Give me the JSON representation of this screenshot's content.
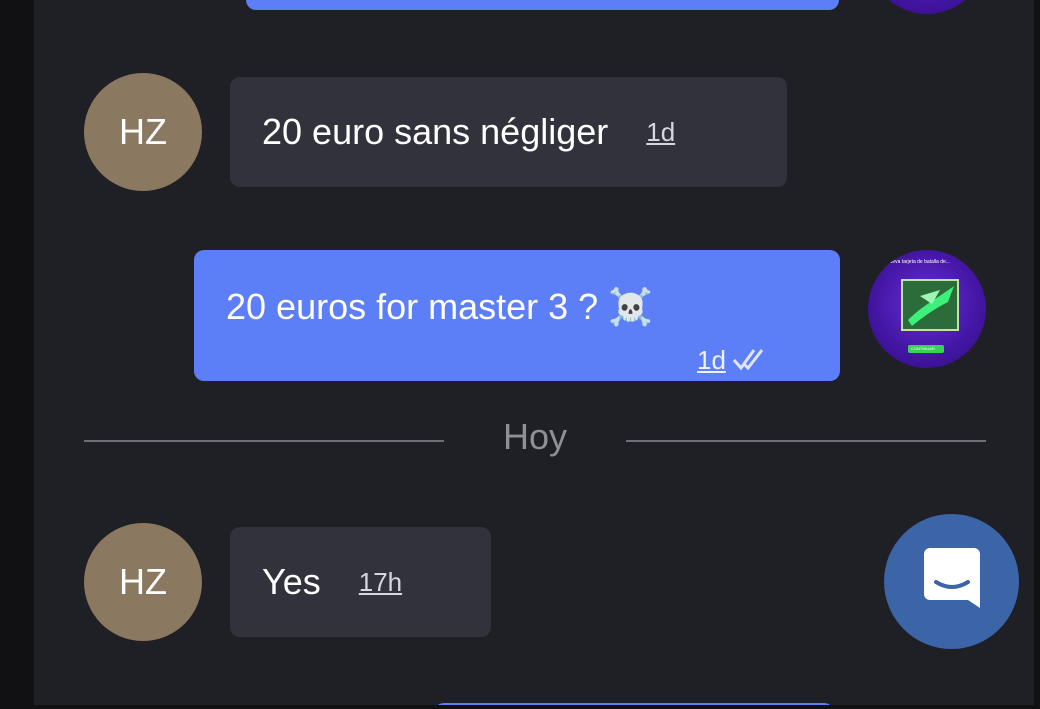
{
  "messages": [
    {
      "sender_initials": "HZ",
      "text": "20 euro sans négliger",
      "time": "1d"
    },
    {
      "text": "20 euros for master 3 ? ☠️",
      "time": "1d"
    },
    {
      "sender_initials": "HZ",
      "text": "Yes",
      "time": "17h"
    }
  ],
  "day_divider": {
    "label": "Hoy"
  },
  "outgoing_avatar": {
    "caption": "Nueva tarjeta de batalla de...",
    "button_text": "CONTINUAR"
  },
  "messenger_button": {
    "icon": "chat-bubble-smile-icon"
  },
  "colors": {
    "background": "#1f1f26",
    "incoming_bubble": "#32323c",
    "outgoing_bubble": "#5c7ef7",
    "avatar": "#8b7860",
    "fab": "#3c65a8"
  }
}
